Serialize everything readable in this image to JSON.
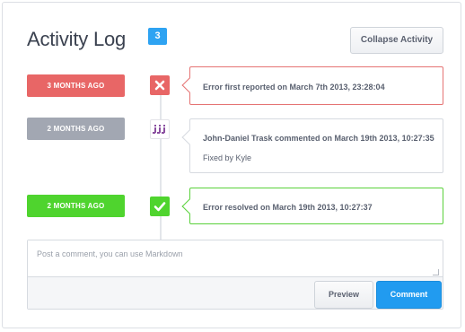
{
  "header": {
    "title": "Activity Log",
    "count": "3",
    "collapse_label": "Collapse Activity"
  },
  "timeline": [
    {
      "time_label": "3 months ago",
      "label_color": "#e86666",
      "marker_icon": "close-icon",
      "marker_color": "#e86666",
      "text": "Error first reported on March 7th 2013, 23:28:04",
      "card_style": "red"
    },
    {
      "time_label": "2 months ago",
      "label_color": "#a2a7b2",
      "marker_icon": "avatar",
      "text": "John-Daniel Trask commented on March 19th 2013, 10:27:35",
      "note": "Fixed by Kyle",
      "card_style": "gray"
    },
    {
      "time_label": "2 months ago",
      "label_color": "#4fd42e",
      "marker_icon": "check-icon",
      "marker_color": "#4fd42e",
      "text": "Error resolved on March 19th 2013, 10:27:37",
      "card_style": "green"
    }
  ],
  "comment": {
    "placeholder": "Post a comment, you can use Markdown",
    "value": "",
    "preview_label": "Preview",
    "submit_label": "Comment"
  },
  "colors": {
    "accent": "#219bf0",
    "badge": "#2ea3f2"
  }
}
